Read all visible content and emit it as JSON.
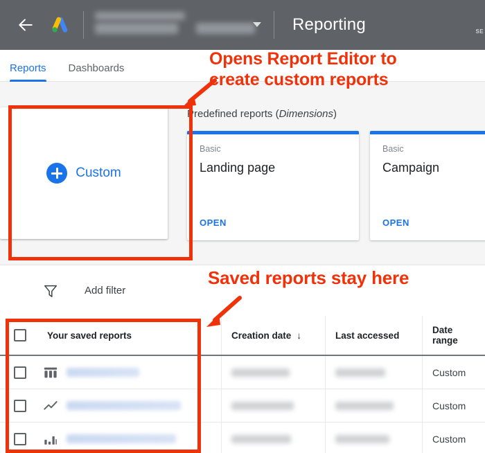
{
  "appbar": {
    "back_icon": "arrow-left-icon",
    "logo": "google-ads-logo",
    "account_caret": "chevron-down-icon",
    "title": "Reporting",
    "corner_label": "SE"
  },
  "tabs": [
    {
      "label": "Reports",
      "active": true
    },
    {
      "label": "Dashboards",
      "active": false
    }
  ],
  "custom_card": {
    "label": "Custom",
    "icon": "plus-circle-icon"
  },
  "predefined": {
    "title_prefix": "Predefined reports (",
    "title_em": "Dimensions",
    "title_suffix": ")",
    "cards": [
      {
        "kicker": "Basic",
        "title": "Landing page",
        "open_label": "OPEN"
      },
      {
        "kicker": "Basic",
        "title": "Campaign",
        "open_label": "OPEN"
      }
    ]
  },
  "filterbar": {
    "icon": "filter-funnel-icon",
    "add_filter_label": "Add filter"
  },
  "table": {
    "columns": {
      "name": "Your saved reports",
      "creation_date": "Creation date",
      "sort_indicator": "↓",
      "last_accessed": "Last accessed",
      "date_range": "Date\nrange"
    },
    "rows": [
      {
        "icon": "table-chart-icon",
        "name": "",
        "creation_date": "",
        "last_accessed": "",
        "date_range": "Custom"
      },
      {
        "icon": "line-chart-icon",
        "name": "",
        "creation_date": "",
        "last_accessed": "",
        "date_range": "Custom"
      },
      {
        "icon": "bar-chart-icon",
        "name": "",
        "creation_date": "",
        "last_accessed": "",
        "date_range": "Custom"
      }
    ]
  },
  "annotations": {
    "color": "#f0320a",
    "callout_top": "Opens Report Editor to\ncreate custom reports",
    "callout_bottom": "Saved reports stay here"
  },
  "colors": {
    "appbar_bg": "#5f6368",
    "accent_blue": "#1a73e8",
    "strip_bg": "#f5f5f5",
    "annotation_red": "#f0320a"
  }
}
